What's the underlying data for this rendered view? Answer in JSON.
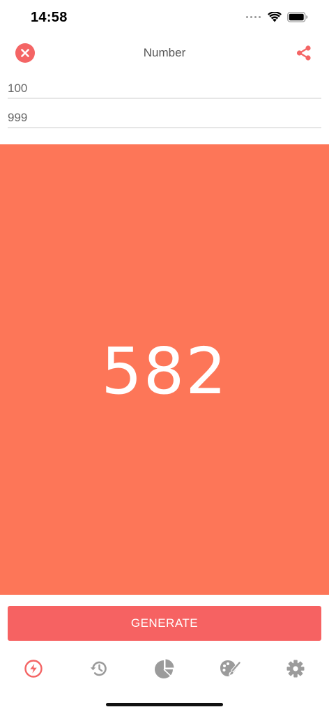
{
  "status_bar": {
    "time": "14:58",
    "icons": [
      "cellular-signal-icon",
      "wifi-icon",
      "battery-icon"
    ]
  },
  "header": {
    "title": "Number",
    "close_icon": "close-icon",
    "share_icon": "share-icon"
  },
  "inputs": {
    "min_value": "100",
    "max_value": "999"
  },
  "result": {
    "value": "582",
    "background_color": "#fd7658"
  },
  "generate_button": {
    "label": "GENERATE",
    "color": "#f66262"
  },
  "tab_bar": {
    "active_color": "#f46565",
    "inactive_color": "#9b9b9b",
    "tabs": [
      {
        "icon": "lightning-icon",
        "active": true
      },
      {
        "icon": "history-icon",
        "active": false
      },
      {
        "icon": "pie-chart-icon",
        "active": false
      },
      {
        "icon": "palette-icon",
        "active": false
      },
      {
        "icon": "gear-icon",
        "active": false
      }
    ]
  }
}
